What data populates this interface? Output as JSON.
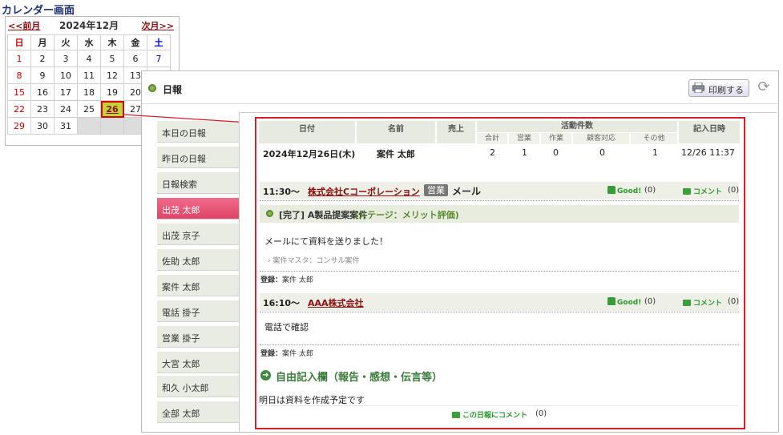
{
  "calendar": {
    "title": "カレンダー画面",
    "prev": "<<前月",
    "month": "2024年12月",
    "next": "次月>>",
    "weekdays": [
      "日",
      "月",
      "火",
      "水",
      "木",
      "金",
      "土"
    ],
    "weeks": [
      [
        "1",
        "2",
        "3",
        "4",
        "5",
        "6",
        "7"
      ],
      [
        "8",
        "9",
        "10",
        "11",
        "12",
        "13",
        ""
      ],
      [
        "15",
        "16",
        "17",
        "18",
        "19",
        "20",
        ""
      ],
      [
        "22",
        "23",
        "24",
        "25",
        "26",
        "27",
        ""
      ],
      [
        "29",
        "30",
        "31",
        "",
        "",
        "",
        ""
      ]
    ],
    "selected_day": "26"
  },
  "panel": {
    "title": "日報",
    "print_label": "印刷する"
  },
  "name_list": [
    "本日の日報",
    "昨日の日報",
    "日報検索",
    "出茂 太郎",
    "出茂 京子",
    "佐助 太郎",
    "案件 太郎",
    "電話 掛子",
    "営業 掛子",
    "大宮 太郎",
    "和久 小太郎",
    "全部 太郎"
  ],
  "active_name": "出茂 太郎",
  "summary": {
    "headers": {
      "date": "日付",
      "name": "名前",
      "sales": "売上",
      "activity": "活動件数",
      "entry_time": "記入日時"
    },
    "sub_headers": [
      "合計",
      "営業",
      "作業",
      "顧客対応",
      "その他"
    ],
    "row": {
      "date": "2024年12月26日(木)",
      "name": "案件 太郎",
      "total": "2",
      "sales": "1",
      "work": "0",
      "customer": "0",
      "other": "1",
      "entry_time": "12/26 11:37"
    }
  },
  "entries": [
    {
      "time": "11:30〜",
      "company": "株式会社Cコーポレーション",
      "tag": "営業",
      "method": "メール",
      "good_label": "Good!",
      "good_count": "(0)",
      "comment_label": "コメント",
      "comment_count": "(0)",
      "deal_status": "[完了] A製品提案案件",
      "deal_stage": "(ステージ：メリット評価)",
      "body": "メールにて資料を送りました！",
      "master": "案件マスタ：コンサル案件",
      "reg_label": "登録：",
      "reg_name": "案件 太郎"
    },
    {
      "time": "16:10〜",
      "company": "AAA株式会社",
      "good_label": "Good!",
      "good_count": "(0)",
      "comment_label": "コメント",
      "comment_count": "(0)",
      "body": "電話で確認",
      "reg_label": "登録：",
      "reg_name": "案件 太郎"
    }
  ],
  "free_entry": {
    "title": "自由記入欄（報告・感想・伝言等）",
    "body": "明日は資料を作成予定です",
    "comment_label": "この日報にコメント",
    "comment_count": "(0)"
  }
}
